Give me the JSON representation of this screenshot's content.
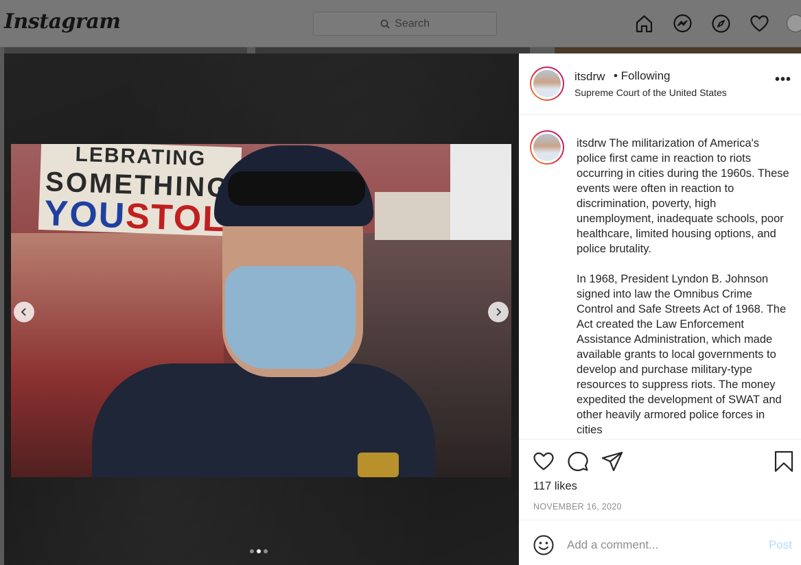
{
  "topbar": {
    "logo": "Instagram",
    "search_placeholder": "Search",
    "nav_icons": [
      "home-icon",
      "messenger-icon",
      "explore-icon",
      "activity-heart-icon",
      "profile-avatar"
    ]
  },
  "post": {
    "username": "itsdrw",
    "follow_status": "• Following",
    "location": "Supreme Court of the United States",
    "caption_username": "itsdrw",
    "caption_p1": "The militarization of America's police first came in reaction to riots occurring in cities during the 1960s. These events were often in reaction to discrimination, poverty, high unemployment, inadequate schools, poor healthcare, limited housing options, and police brutality.",
    "caption_p2": "In 1968, President Lyndon B. Johnson signed into law the Omnibus Crime Control and Safe Streets Act of 1968. The Act created the Law Enforcement Assistance Administration, which made available grants to local governments to develop and purchase military-type resources to suppress riots. The money expedited the development of SWAT and other heavily armored police forces in cities",
    "likes": "117 likes",
    "date": "NOVEMBER 16, 2020",
    "comment_placeholder": "Add a comment...",
    "post_button": "Post",
    "carousel": {
      "count": 3,
      "active_index": 1
    }
  },
  "photo_signs": {
    "sign_line1": "LEBRATING",
    "sign_line2": "SOMETHING",
    "sign_you": "YOU",
    "sign_stole": "STOLE"
  },
  "colors": {
    "instagram_gradient": [
      "#f09433",
      "#dc2743",
      "#bc1888"
    ],
    "post_button": "#b3dbff",
    "muted_text": "#8e8e8e"
  }
}
